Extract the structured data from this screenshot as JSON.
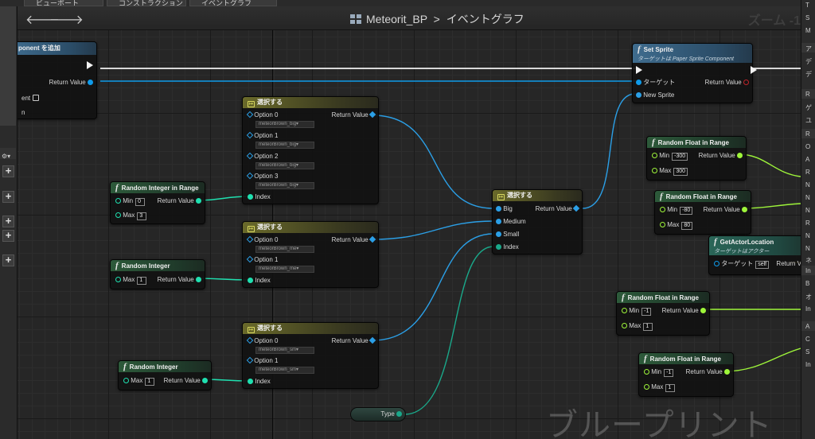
{
  "tabs": [
    "ビューポート",
    "コンストラクション",
    "イベントグラフ"
  ],
  "header": {
    "title": "Meteorit_BP",
    "separator": ">",
    "graph": "イベントグラフ",
    "zoom": "ズーム -1",
    "back_icon": "arrow-left-icon",
    "forward_icon": "arrow-right-icon"
  },
  "watermark": "ブループリント",
  "colors": {
    "exec": "#f2f2f2",
    "object": "#0f9bea",
    "float": "#9ef53a",
    "int": "#1fe0b0",
    "wildcard_blue": "#2b9fe6"
  },
  "left_panel_buttons": [
    "+",
    "+",
    "+",
    "+",
    "+"
  ],
  "right_panel_items": [
    "T",
    "S",
    "M",
    "ア",
    "デ",
    "デ",
    "R",
    "ゲ",
    "ユ",
    "R",
    "O",
    "A",
    "R",
    "N",
    "N",
    "N",
    "R",
    "N",
    "N",
    "ネ",
    "In",
    "B",
    "オ",
    "In",
    "A",
    "C",
    "S",
    "In"
  ],
  "nodes": {
    "add_component": {
      "title": "ponent を追加",
      "return_value": "Return Value",
      "partial_label1": "ent",
      "partial_label2": "n"
    },
    "set_sprite": {
      "title": "Set Sprite",
      "subtitle": "ターゲットは Paper Sprite Component",
      "target": "ターゲット",
      "new_sprite": "New Sprite",
      "return_value": "Return Value"
    },
    "select1": {
      "title": "選択する",
      "options": [
        {
          "label": "Option 0",
          "value": "meteorBrown_big"
        },
        {
          "label": "Option 1",
          "value": "meteorBrown_big"
        },
        {
          "label": "Option 2",
          "value": "meteorBrown_big"
        },
        {
          "label": "Option 3",
          "value": "meteorBrown_big"
        }
      ],
      "return_value": "Return Value",
      "index": "Index"
    },
    "select2": {
      "title": "選択する",
      "options": [
        {
          "label": "Option 0",
          "value": "meteorBrown_me"
        },
        {
          "label": "Option 1",
          "value": "meteorBrown_me"
        }
      ],
      "return_value": "Return Value",
      "index": "Index"
    },
    "select3": {
      "title": "選択する",
      "options": [
        {
          "label": "Option 0",
          "value": "meteorBrown_sm"
        },
        {
          "label": "Option 1",
          "value": "meteorBrown_sm"
        }
      ],
      "return_value": "Return Value",
      "index": "Index"
    },
    "select_main": {
      "title": "選択する",
      "inputs": [
        "Big",
        "Medium",
        "Small",
        "Index"
      ],
      "return_value": "Return Value"
    },
    "rand_int_range": {
      "title": "Random Integer in Range",
      "min_label": "Min",
      "min": "0",
      "max_label": "Max",
      "max": "3",
      "return_value": "Return Value"
    },
    "rand_int1": {
      "title": "Random Integer",
      "max_label": "Max",
      "max": "1",
      "return_value": "Return Value"
    },
    "rand_int2": {
      "title": "Random Integer",
      "max_label": "Max",
      "max": "1",
      "return_value": "Return Value"
    },
    "type_var": {
      "label": "Type"
    },
    "rfr1": {
      "title": "Random Float in Range",
      "min_label": "Min",
      "min": "-300",
      "max_label": "Max",
      "max": "300",
      "return_value": "Return Value"
    },
    "rfr2": {
      "title": "Random Float in Range",
      "min_label": "Min",
      "min": "-80",
      "max_label": "Max",
      "max": "80",
      "return_value": "Return Value"
    },
    "get_actor_location": {
      "title": "GetActorLocation",
      "subtitle": "ターゲットはアクター",
      "target": "ターゲット",
      "self": "self",
      "return_value": "Return V"
    },
    "rfr3": {
      "title": "Random Float in Range",
      "min_label": "Min",
      "min": "-1",
      "max_label": "Max",
      "max": "1",
      "return_value": "Return Value"
    },
    "rfr4": {
      "title": "Random Float in Range",
      "min_label": "Min",
      "min": "-1",
      "max_label": "Max",
      "max": "1",
      "return_value": "Return Value"
    }
  }
}
